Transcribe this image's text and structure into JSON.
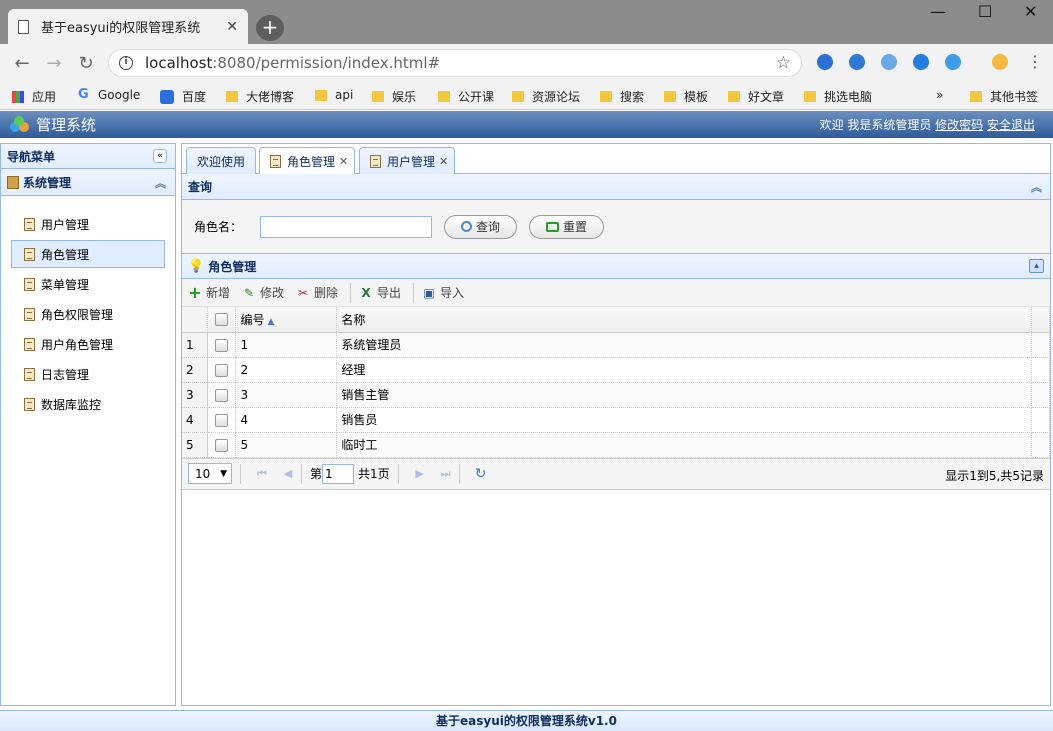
{
  "browser": {
    "tab_title": "基于easyui的权限管理系统",
    "tab_close": "✕",
    "new_tab": "+",
    "win_min": "—",
    "win_max": "☐",
    "win_close": "✕",
    "back": "←",
    "forward": "→",
    "reload": "↻",
    "url_host": "localhost",
    "url_path": ":8080/permission/index.html#",
    "info": "i",
    "star": "☆",
    "menu": "⋮",
    "bookmarks": [
      "应用",
      "Google",
      "百度",
      "大佬博客",
      "api",
      "娱乐",
      "公开课",
      "资源论坛",
      "搜索",
      "模板",
      "好文章",
      "挑选电脑"
    ],
    "bookmarks_more": "»",
    "bookmarks_other": "其他书签"
  },
  "app": {
    "title": "管理系统",
    "welcome": "欢迎 我是系统管理员 ",
    "change_password": "修改密码",
    "logout": "安全退出"
  },
  "west": {
    "title": "导航菜单",
    "collapse": "«",
    "section": "系统管理",
    "section_toggle": "︽",
    "items": [
      "用户管理",
      "角色管理",
      "菜单管理",
      "角色权限管理",
      "用户角色管理",
      "日志管理",
      "数据库监控"
    ]
  },
  "tabs": [
    {
      "label": "欢迎使用"
    },
    {
      "label": "角色管理",
      "close": "✕"
    },
    {
      "label": "用户管理",
      "close": "✕"
    }
  ],
  "query": {
    "title": "查询",
    "toggle": "︽",
    "field_label": "角色名：",
    "field_value": "",
    "search_button": "查询",
    "reset_button": "重置"
  },
  "grid": {
    "title": "角色管理",
    "collapse": "▴",
    "toolbar": [
      {
        "label": "新增",
        "icon": "+",
        "color": "#1a9a1a"
      },
      {
        "label": "修改",
        "icon": "✎",
        "color": "#2a8a2a"
      },
      {
        "label": "删除",
        "icon": "✂",
        "color": "#c03030"
      },
      {
        "label": "导出",
        "icon": "X",
        "color": "#1f7a3a"
      },
      {
        "label": "导入",
        "icon": "▣",
        "color": "#2a5a9a"
      }
    ],
    "columns": [
      "编号",
      "名称"
    ],
    "sort_indicator": "▲",
    "rows": [
      {
        "rn": "1",
        "id": "1",
        "name": "系统管理员"
      },
      {
        "rn": "2",
        "id": "2",
        "name": "经理"
      },
      {
        "rn": "3",
        "id": "3",
        "name": "销售主管"
      },
      {
        "rn": "4",
        "id": "4",
        "name": "销售员"
      },
      {
        "rn": "5",
        "id": "5",
        "name": "临时工"
      }
    ],
    "pager": {
      "page_size": "10",
      "first": "⏮",
      "prev": "◀",
      "page_prefix": "第",
      "page_value": "1",
      "page_suffix": "共1页",
      "next": "▶",
      "last": "⏭",
      "refresh": "↻",
      "info": "显示1到5,共5记录"
    }
  },
  "footer": "基于easyui的权限管理系统v1.0"
}
